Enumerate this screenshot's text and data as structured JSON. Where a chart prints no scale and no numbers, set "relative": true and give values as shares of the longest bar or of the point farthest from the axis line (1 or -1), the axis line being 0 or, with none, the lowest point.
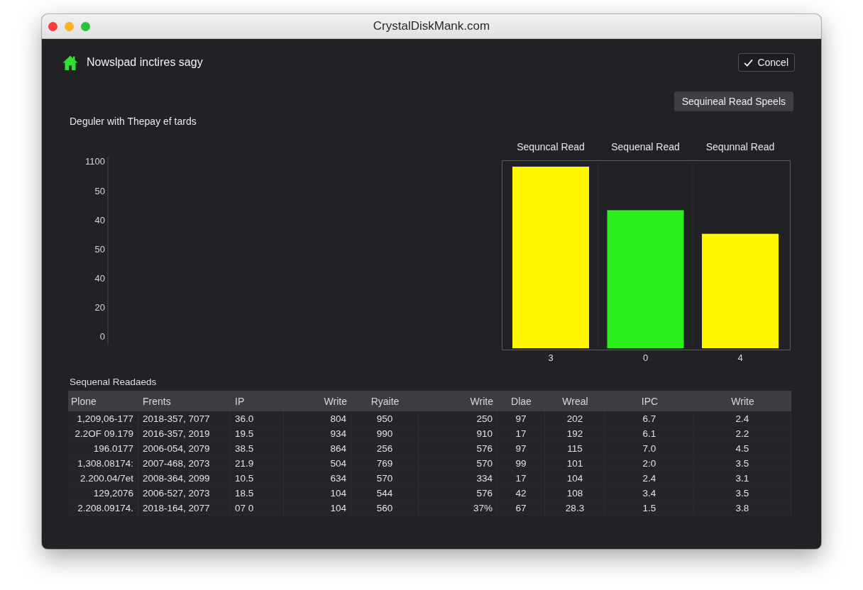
{
  "window": {
    "title": "CrystalDiskMank.com"
  },
  "header": {
    "title": "Nowslpad inctires sagy",
    "confirm_button": "Concel"
  },
  "view_button": "Sequineal Read Speels",
  "chart": {
    "axis_labels": [
      "1100",
      "50",
      "40",
      "50",
      "40",
      "20",
      "0"
    ],
    "chart_data": {
      "type": "bar",
      "title": "Deguler with Thepay ef tards",
      "categories": [
        "3",
        "0",
        "4"
      ],
      "values": [
        1,
        0.76,
        0.63
      ],
      "relative": true,
      "colors": [
        "#fff700",
        "#2ef01e",
        "#fff700"
      ],
      "annotations": [
        "Sequncal Read",
        "Sequenal Read",
        "Sequnnal Read"
      ]
    }
  },
  "table": {
    "title": "Sequenal Readaeds",
    "columns": [
      "Plone",
      "Frents",
      "IP",
      "Write",
      "Ryaite",
      "Write",
      "Dlae",
      "Wreal",
      "IPC",
      "Write"
    ],
    "rows": [
      [
        "1,209,06-177",
        "2018-357, 7077",
        "36.0",
        "804",
        "950",
        "250",
        "97",
        "202",
        "6.7",
        "2.4"
      ],
      [
        "2.2OF 09.179",
        "2016-357, 2019",
        "19.5",
        "934",
        "990",
        "910",
        "17",
        "192",
        "6.1",
        "2.2"
      ],
      [
        "196.0177",
        "2006-054, 2079",
        "38.5",
        "864",
        "256",
        "576",
        "97",
        "115",
        "7.0",
        "4.5"
      ],
      [
        "1,308.08174:",
        "2007-468, 2073",
        "21.9",
        "504",
        "769",
        "570",
        "99",
        "101",
        "2:0",
        "3.5"
      ],
      [
        "2.200.04/7et",
        "2008-364, 2099",
        "10.5",
        "634",
        "570",
        "334",
        "17",
        "104",
        "2.4",
        "3.1"
      ],
      [
        "129,2076",
        "2006-527, 2073",
        "18.5",
        "104",
        "544",
        "576",
        "42",
        "108",
        "3.4",
        "3.5"
      ],
      [
        "2.208.09174.",
        "2018-164, 2077",
        "07 0",
        "104",
        "560",
        "37%",
        "67",
        "28.3",
        "1.5",
        "3.8"
      ]
    ]
  }
}
